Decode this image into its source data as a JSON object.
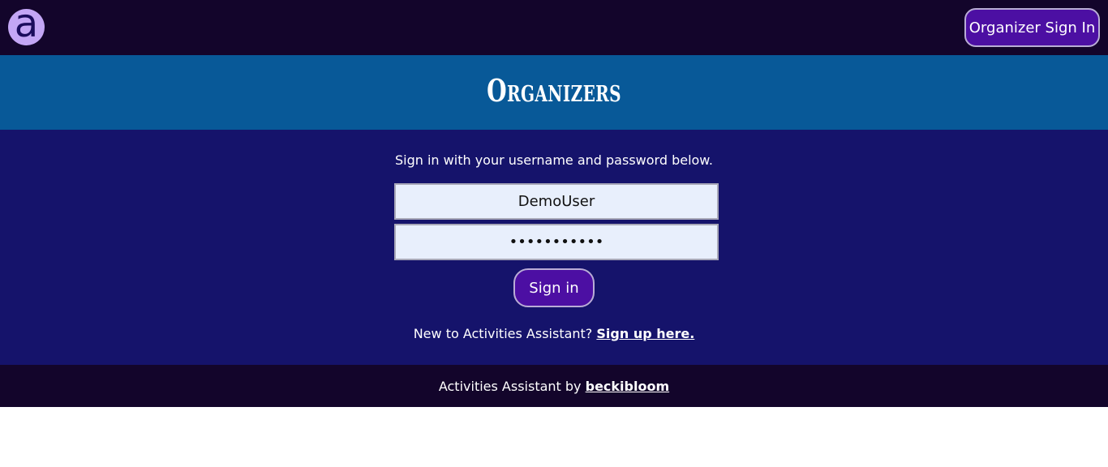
{
  "header": {
    "logo_letter": "a",
    "signin_button_label": "Organizer Sign In",
    "colors": {
      "bar": "#13052b",
      "logo_bg": "#c3a6f5",
      "button": "#4c0fa3"
    }
  },
  "hero": {
    "title": "Organizers",
    "background": "#085998"
  },
  "form": {
    "intro": "Sign in with your username and password below.",
    "username_value": "DemoUser",
    "password_value": "•••••••••••",
    "signin_label": "Sign in",
    "background": "#15136b"
  },
  "signup": {
    "prompt": "New to Activities Assistant? ",
    "link_label": "Sign up here."
  },
  "footer": {
    "text": "Activities Assistant by ",
    "author": "beckibloom"
  }
}
